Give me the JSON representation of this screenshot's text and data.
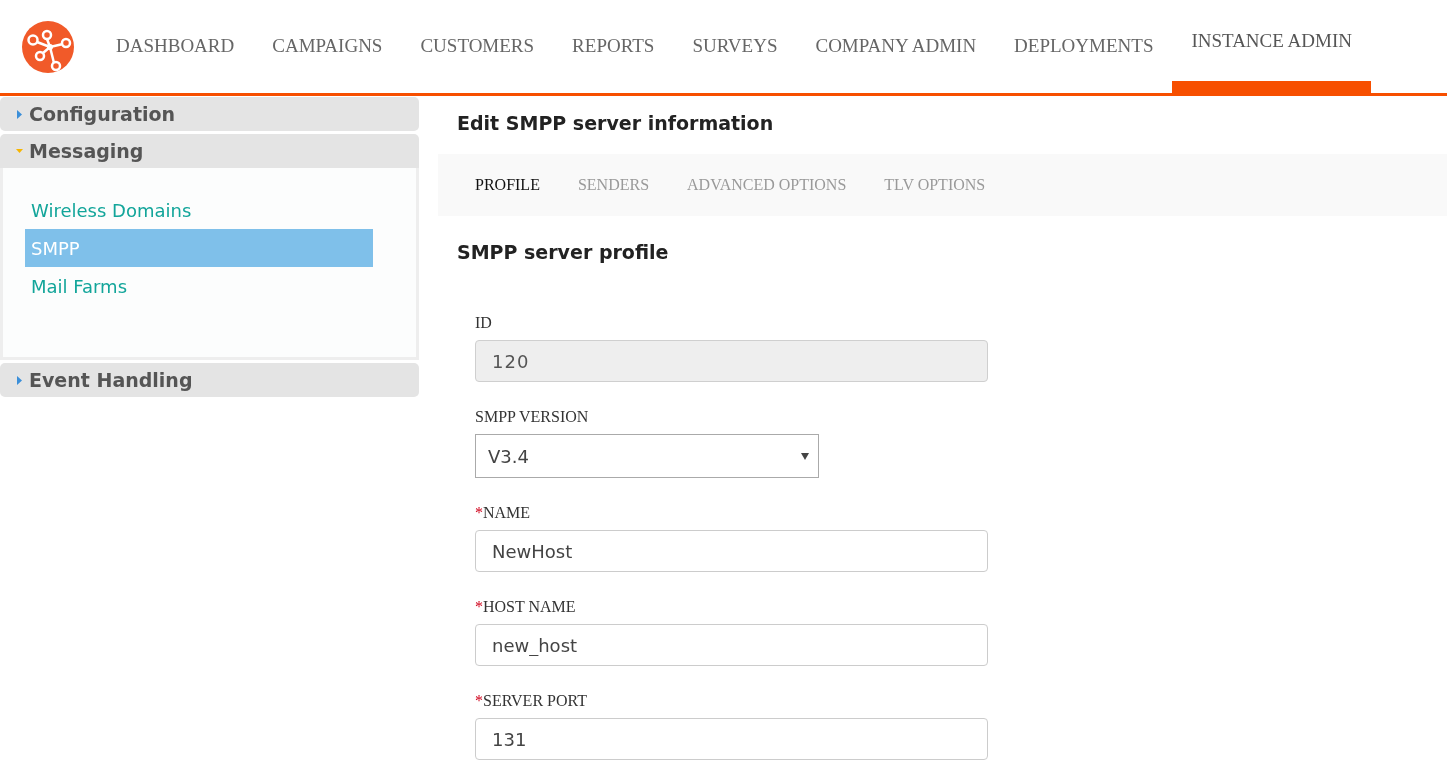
{
  "nav": {
    "items": [
      {
        "label": "DASHBOARD",
        "selected": false
      },
      {
        "label": "CAMPAIGNS",
        "selected": false
      },
      {
        "label": "CUSTOMERS",
        "selected": false
      },
      {
        "label": "REPORTS",
        "selected": false
      },
      {
        "label": "SURVEYS",
        "selected": false
      },
      {
        "label": "COMPANY ADMIN",
        "selected": false
      },
      {
        "label": "DEPLOYMENTS",
        "selected": false
      },
      {
        "label": "INSTANCE ADMIN",
        "selected": true
      }
    ]
  },
  "sidebar": {
    "sections": [
      {
        "title": "Configuration",
        "expanded": false
      },
      {
        "title": "Messaging",
        "expanded": true,
        "items": [
          {
            "label": "Wireless Domains",
            "selected": false
          },
          {
            "label": "SMPP",
            "selected": true
          },
          {
            "label": "Mail Farms",
            "selected": false
          }
        ]
      },
      {
        "title": "Event Handling",
        "expanded": false
      }
    ]
  },
  "page_title": "Edit SMPP server information",
  "tabs": [
    {
      "label": "PROFILE",
      "selected": true
    },
    {
      "label": "SENDERS",
      "selected": false
    },
    {
      "label": "ADVANCED OPTIONS",
      "selected": false
    },
    {
      "label": "TLV OPTIONS",
      "selected": false
    }
  ],
  "section_title": "SMPP server profile",
  "fields": [
    {
      "kind": "text",
      "label": "ID",
      "disabled": true,
      "value": "120"
    },
    {
      "kind": "select",
      "label": "SMPP VERSION",
      "disabled": false,
      "value": "V3.4"
    },
    {
      "kind": "text",
      "required_mark": "*",
      "label": "NAME",
      "disabled": false,
      "value": "NewHost"
    },
    {
      "kind": "text",
      "required_mark": "*",
      "label": "HOST NAME",
      "disabled": false,
      "value": "new_host"
    },
    {
      "kind": "text",
      "required_mark": "*",
      "label": "SERVER PORT",
      "disabled": false,
      "value": "131"
    }
  ]
}
